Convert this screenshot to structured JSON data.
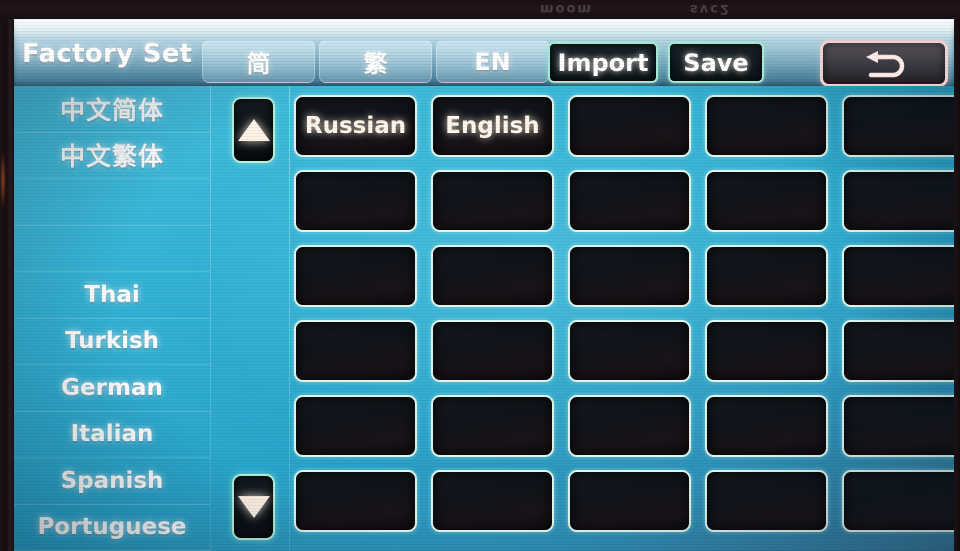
{
  "header": {
    "title": "Factory Set",
    "tabs": [
      {
        "label": "简",
        "name": "tab-simplified-chinese"
      },
      {
        "label": "繁",
        "name": "tab-traditional-chinese"
      },
      {
        "label": "EN",
        "name": "tab-english"
      }
    ],
    "buttons": [
      {
        "label": "Import",
        "name": "import-button"
      },
      {
        "label": "Save",
        "name": "save-button"
      }
    ],
    "back_button": {
      "icon": "back-arrow-icon",
      "label": ""
    },
    "colors": {
      "header_top": "#e2f2f7",
      "header_bottom": "#3c6f8a",
      "button_border": "#a9ead9",
      "back_border": "#ffe1de"
    }
  },
  "sidebar": {
    "items": [
      {
        "label": "中文简体",
        "cjk": true
      },
      {
        "label": "中文繁体",
        "cjk": true
      },
      {
        "label": "",
        "cjk": false
      },
      {
        "label": "",
        "cjk": false
      },
      {
        "label": "Thai",
        "cjk": false
      },
      {
        "label": "Turkish",
        "cjk": false
      },
      {
        "label": "German",
        "cjk": false
      },
      {
        "label": "Italian",
        "cjk": false
      },
      {
        "label": "Spanish",
        "cjk": false
      },
      {
        "label": "Portuguese",
        "cjk": false
      }
    ]
  },
  "scroll": {
    "up_label": "",
    "down_label": "",
    "up_icon": "triangle-up-icon",
    "down_icon": "triangle-down-icon"
  },
  "grid": {
    "columns": 5,
    "rows": 6,
    "cells": [
      "Russian",
      "English",
      "",
      "",
      "",
      "",
      "",
      "",
      "",
      "",
      "",
      "",
      "",
      "",
      "",
      "",
      "",
      "",
      "",
      "",
      "",
      "",
      "",
      "",
      "",
      "",
      "",
      "",
      "",
      ""
    ],
    "colors": {
      "cell_fill": "#12151b",
      "cell_border": "#dff6ee",
      "background": "#2aa6cc"
    }
  },
  "bezel": {
    "ghost_a": "moom",
    "ghost_b": "svc2"
  }
}
